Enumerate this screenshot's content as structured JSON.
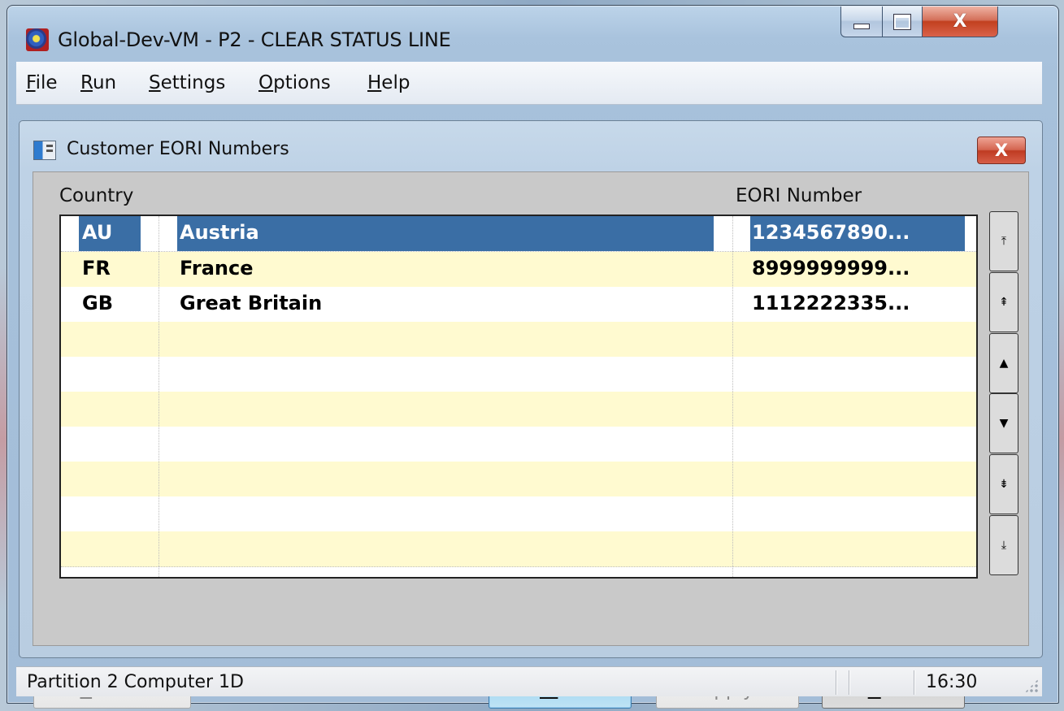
{
  "window": {
    "title": "Global-Dev-VM - P2 - CLEAR STATUS LINE",
    "minimize_icon": "minimize-icon",
    "maximize_icon": "maximize-icon",
    "close_label": "X"
  },
  "menu": {
    "items": [
      {
        "label_u": "F",
        "label_rest": "ile"
      },
      {
        "label_u": "R",
        "label_rest": "un"
      },
      {
        "label_u": "S",
        "label_rest": "ettings"
      },
      {
        "label_u": "O",
        "label_rest": "ptions"
      },
      {
        "label_u": "H",
        "label_rest": "elp"
      }
    ]
  },
  "dialog": {
    "title": "Customer EORI Numbers",
    "close_label": "X",
    "headers": {
      "country": "Country",
      "eori": "EORI Number"
    },
    "rows": [
      {
        "code": "AU",
        "name": "Austria",
        "eori": "1234567890...",
        "selected": true
      },
      {
        "code": "FR",
        "name": "France",
        "eori": "8999999999...",
        "selected": false
      },
      {
        "code": "GB",
        "name": "Great Britain",
        "eori": "1112222335...",
        "selected": false
      }
    ],
    "empty_rows": 7,
    "scroll_buttons": [
      "⤒",
      "⇞",
      "▲",
      "▼",
      "⇟",
      "⤓"
    ],
    "buttons": {
      "search": {
        "u": "S",
        "rest": "earch"
      },
      "amend": {
        "pre": "A",
        "u": "m",
        "rest": "end"
      },
      "apply": {
        "label": "Apply"
      },
      "close": {
        "u": "C",
        "rest": "lose"
      }
    },
    "colors": {
      "selection": "#3a6ea5",
      "row_alt": "#fffad0"
    }
  },
  "status": {
    "text": "Partition 2 Computer 1D",
    "time": "16:30"
  }
}
